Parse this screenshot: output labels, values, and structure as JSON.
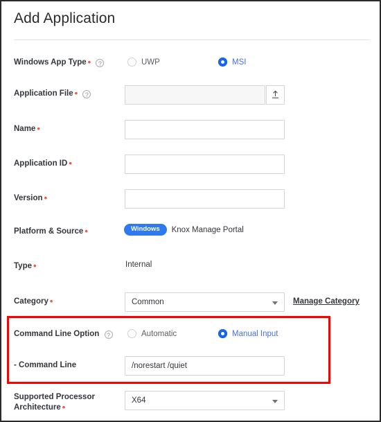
{
  "header": {
    "title": "Add Application"
  },
  "form": {
    "windows_app_type": {
      "label": "Windows App Type",
      "required": true,
      "help_icon": "question-mark-icon",
      "options": [
        {
          "label": "UWP",
          "selected": false
        },
        {
          "label": "MSI",
          "selected": true
        }
      ]
    },
    "application_file": {
      "label": "Application File",
      "required": true,
      "help_icon": "question-mark-icon",
      "value": "",
      "placeholder": "",
      "upload_icon": "upload-icon"
    },
    "name": {
      "label": "Name",
      "required": true,
      "value": "",
      "placeholder": ""
    },
    "application_id": {
      "label": "Application ID",
      "required": true,
      "value": "",
      "placeholder": ""
    },
    "version": {
      "label": "Version",
      "required": true,
      "value": "",
      "placeholder": ""
    },
    "platform_source": {
      "label": "Platform & Source",
      "required": true,
      "badge": "Windows",
      "source": "Knox Manage Portal"
    },
    "type": {
      "label": "Type",
      "required": true,
      "value": "Internal"
    },
    "category": {
      "label": "Category",
      "required": true,
      "value": "Common",
      "manage_link": "Manage Category"
    },
    "command_line_option": {
      "label": "Command Line Option",
      "required": false,
      "help_icon": "question-mark-icon",
      "options": [
        {
          "label": "Automatic",
          "selected": false
        },
        {
          "label": "Manual Input",
          "selected": true
        }
      ]
    },
    "command_line": {
      "label": "- Command Line",
      "required": false,
      "value": "/norestart /quiet",
      "placeholder": ""
    },
    "supported_processor_architecture": {
      "label_line1": "Supported Processor",
      "label_line2": "Architecture",
      "required": true,
      "value": "X64"
    }
  },
  "annotation": {
    "highlight_color": "#fe0000",
    "accent_color": "#1565ee",
    "required_marker_color": "#ec5b4c"
  }
}
